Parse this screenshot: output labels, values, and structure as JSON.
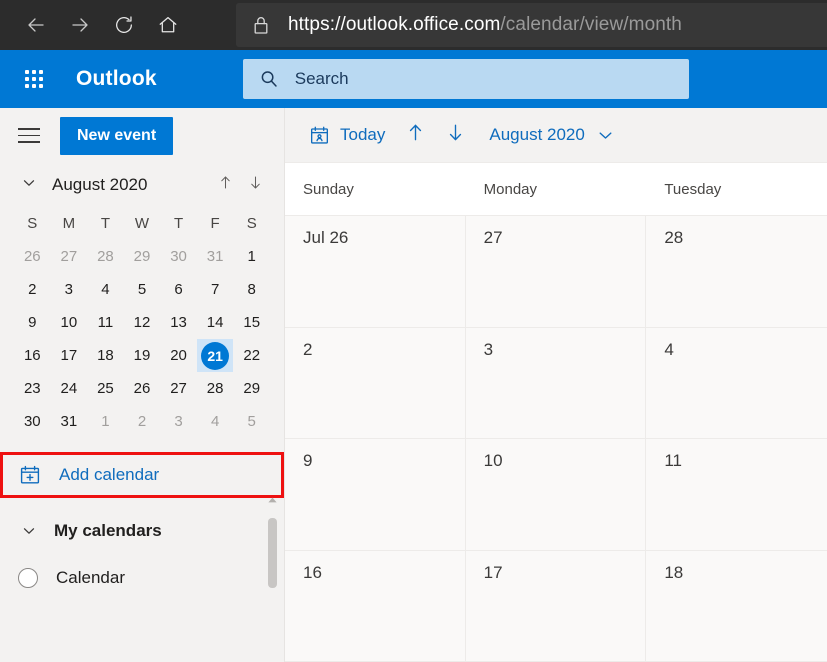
{
  "browser": {
    "back_icon": "back-arrow-icon",
    "forward_icon": "forward-arrow-icon",
    "reload_icon": "reload-icon",
    "home_icon": "home-icon",
    "lock_icon": "padlock-icon",
    "url_domain": "https://outlook.office.com",
    "url_path": "/calendar/view/month"
  },
  "header": {
    "app_launcher_icon": "waffle-grid-icon",
    "brand": "Outlook",
    "search_icon": "search-icon",
    "search_placeholder": "Search",
    "brand_color": "#0078d4"
  },
  "sidebar": {
    "menu_icon": "hamburger-menu-icon",
    "new_event_label": "New event",
    "mini_calendar": {
      "collapse_icon": "chevron-down-icon",
      "title": "August 2020",
      "prev_icon": "arrow-up-icon",
      "next_icon": "arrow-down-icon",
      "day_names": [
        "S",
        "M",
        "T",
        "W",
        "T",
        "F",
        "S"
      ],
      "weeks": [
        [
          {
            "n": "26",
            "muted": true
          },
          {
            "n": "27",
            "muted": true
          },
          {
            "n": "28",
            "muted": true
          },
          {
            "n": "29",
            "muted": true
          },
          {
            "n": "30",
            "muted": true
          },
          {
            "n": "31",
            "muted": true
          },
          {
            "n": "1",
            "muted": false
          }
        ],
        [
          {
            "n": "2",
            "muted": false
          },
          {
            "n": "3",
            "muted": false
          },
          {
            "n": "4",
            "muted": false
          },
          {
            "n": "5",
            "muted": false
          },
          {
            "n": "6",
            "muted": false
          },
          {
            "n": "7",
            "muted": false
          },
          {
            "n": "8",
            "muted": false
          }
        ],
        [
          {
            "n": "9",
            "muted": false
          },
          {
            "n": "10",
            "muted": false
          },
          {
            "n": "11",
            "muted": false
          },
          {
            "n": "12",
            "muted": false
          },
          {
            "n": "13",
            "muted": false
          },
          {
            "n": "14",
            "muted": false
          },
          {
            "n": "15",
            "muted": false
          }
        ],
        [
          {
            "n": "16",
            "muted": false
          },
          {
            "n": "17",
            "muted": false
          },
          {
            "n": "18",
            "muted": false
          },
          {
            "n": "19",
            "muted": false
          },
          {
            "n": "20",
            "muted": false
          },
          {
            "n": "21",
            "muted": false,
            "today": true
          },
          {
            "n": "22",
            "muted": false
          }
        ],
        [
          {
            "n": "23",
            "muted": false
          },
          {
            "n": "24",
            "muted": false
          },
          {
            "n": "25",
            "muted": false
          },
          {
            "n": "26",
            "muted": false
          },
          {
            "n": "27",
            "muted": false
          },
          {
            "n": "28",
            "muted": false
          },
          {
            "n": "29",
            "muted": false
          }
        ],
        [
          {
            "n": "30",
            "muted": false
          },
          {
            "n": "31",
            "muted": false
          },
          {
            "n": "1",
            "muted": true
          },
          {
            "n": "2",
            "muted": true
          },
          {
            "n": "3",
            "muted": true
          },
          {
            "n": "4",
            "muted": true
          },
          {
            "n": "5",
            "muted": true
          }
        ]
      ],
      "selected_day": "21"
    },
    "add_calendar": {
      "icon": "calendar-plus-icon",
      "label": "Add calendar",
      "highlight_color": "#ee1111"
    },
    "my_calendars": {
      "chevron_icon": "chevron-down-icon",
      "label": "My calendars",
      "items": [
        {
          "label": "Calendar",
          "checkbox_icon": "circle-unchecked-icon"
        }
      ]
    },
    "scrollbar_icon": "scroll-up-caret-icon"
  },
  "toolbar": {
    "today_icon": "calendar-today-icon",
    "today_label": "Today",
    "prev_icon": "arrow-up-icon",
    "next_icon": "arrow-down-icon",
    "month_label": "August 2020",
    "month_chevron_icon": "chevron-down-icon"
  },
  "calendar_grid": {
    "columns": [
      "Sunday",
      "Monday",
      "Tuesday"
    ],
    "rows": [
      [
        "Jul 26",
        "27",
        "28"
      ],
      [
        "2",
        "3",
        "4"
      ],
      [
        "9",
        "10",
        "11"
      ],
      [
        "16",
        "17",
        "18"
      ]
    ]
  }
}
